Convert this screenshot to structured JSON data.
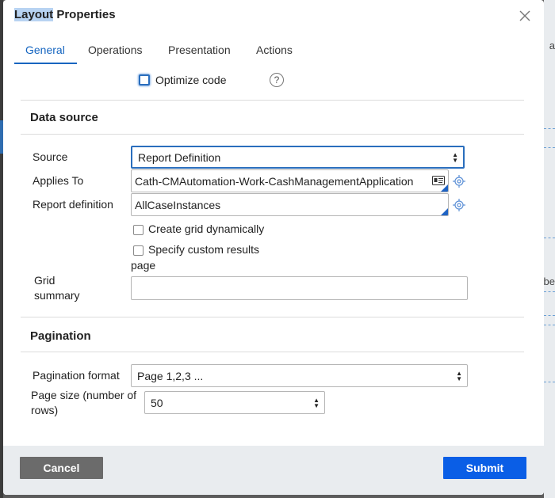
{
  "dialog": {
    "title_highlight": "Layout",
    "title_rest": " Properties",
    "close_label": "×"
  },
  "tabs": [
    {
      "label": "General",
      "active": true
    },
    {
      "label": "Operations",
      "active": false
    },
    {
      "label": "Presentation",
      "active": false
    },
    {
      "label": "Actions",
      "active": false
    }
  ],
  "optimize": {
    "label": "Optimize code",
    "checked": false,
    "help": "?"
  },
  "data_source": {
    "heading": "Data source",
    "source_label": "Source",
    "source_value": "Report Definition",
    "applies_to_label": "Applies To",
    "applies_to_value": "Cath-CMAutomation-Work-CashManagementApplication",
    "report_def_label": "Report definition",
    "report_def_value": "AllCaseInstances",
    "create_grid_label": "Create grid dynamically",
    "custom_results_label_line1": "Specify custom results",
    "custom_results_label_line2": "page",
    "grid_summary_label_line1": "Grid",
    "grid_summary_label_line2": "summary",
    "grid_summary_value": ""
  },
  "pagination": {
    "heading": "Pagination",
    "format_label": "Pagination format",
    "format_value": "Page 1,2,3 ...",
    "page_size_label_line1": "Page size (number of",
    "page_size_label_line2": "rows)",
    "page_size_value": "50"
  },
  "footer": {
    "cancel_label": "Cancel",
    "submit_label": "Submit"
  },
  "background": {
    "edge_letter_1": "a",
    "edge_letter_2": "be"
  },
  "colors": {
    "accent": "#1565c0",
    "submit": "#0a5ee6",
    "cancel": "#6b6b6b",
    "footer_bg": "#e9ecef"
  }
}
